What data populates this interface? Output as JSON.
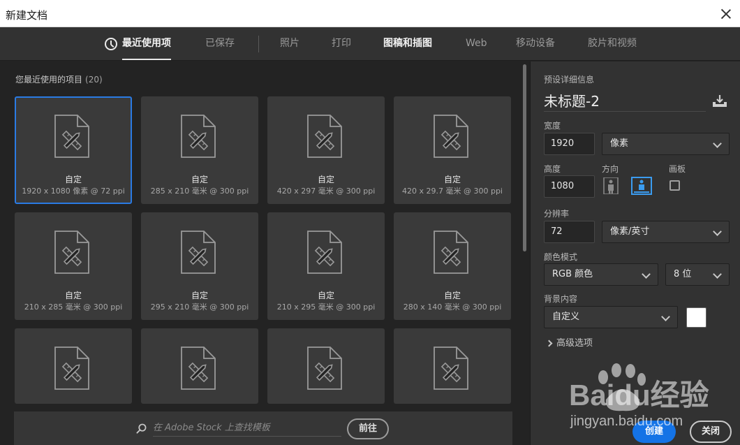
{
  "window": {
    "title": "新建文档"
  },
  "tabs": [
    {
      "label": "最近使用项",
      "active": true
    },
    {
      "label": "已保存"
    },
    {
      "label": "照片"
    },
    {
      "label": "打印"
    },
    {
      "label": "图稿和插图"
    },
    {
      "label": "Web"
    },
    {
      "label": "移动设备"
    },
    {
      "label": "胶片和视频"
    }
  ],
  "recent": {
    "title": "您最近使用的项目",
    "count": "(20)",
    "items": [
      {
        "name": "自定",
        "dims": "1920 x 1080 像素 @ 72 ppi",
        "selected": true
      },
      {
        "name": "自定",
        "dims": "285 x 210 毫米 @ 300 ppi"
      },
      {
        "name": "自定",
        "dims": "420 x 297 毫米 @ 300 ppi"
      },
      {
        "name": "自定",
        "dims": "420 x 29.7 毫米 @ 300 ppi"
      },
      {
        "name": "自定",
        "dims": "210 x 285 毫米 @ 300 ppi"
      },
      {
        "name": "自定",
        "dims": "295 x 210 毫米 @ 300 ppi"
      },
      {
        "name": "自定",
        "dims": "210 x 295 毫米 @ 300 ppi"
      },
      {
        "name": "自定",
        "dims": "280 x 140 毫米 @ 300 ppi"
      },
      {
        "name": "",
        "dims": ""
      },
      {
        "name": "",
        "dims": ""
      },
      {
        "name": "",
        "dims": ""
      },
      {
        "name": "",
        "dims": ""
      }
    ]
  },
  "stock": {
    "placeholder": "在 Adobe Stock 上查找模板",
    "go_label": "前往"
  },
  "preset": {
    "section_label": "预设详细信息",
    "doc_name": "未标题-2",
    "width_label": "宽度",
    "width_value": "1920",
    "width_unit": "像素",
    "height_label": "高度",
    "height_value": "1080",
    "orientation_label": "方向",
    "artboard_label": "画板",
    "resolution_label": "分辨率",
    "resolution_value": "72",
    "resolution_unit": "像素/英寸",
    "color_mode_label": "颜色模式",
    "color_mode": "RGB 颜色",
    "bit_depth": "8 位",
    "background_label": "背景内容",
    "background": "自定义",
    "background_color": "#ffffff",
    "advanced_label": "高级选项"
  },
  "actions": {
    "create": "创建",
    "close": "关闭"
  },
  "watermark": {
    "brand": "Baidu经验",
    "url": "jingyan.baidu.com"
  }
}
